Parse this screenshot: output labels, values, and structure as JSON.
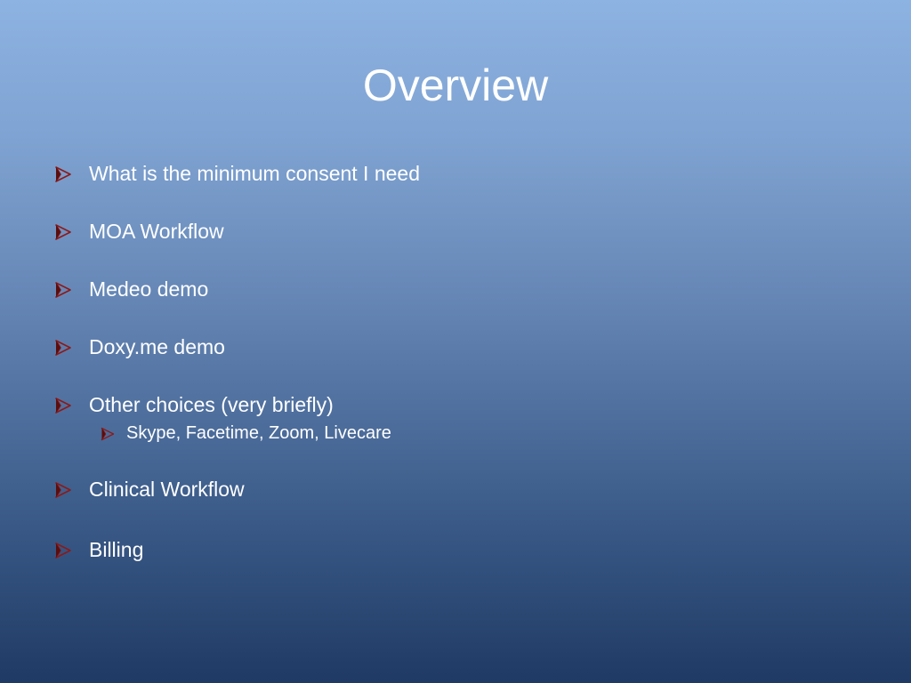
{
  "slide": {
    "title": "Overview",
    "bullet_color": "#8b1a1a",
    "items": [
      {
        "label": "What is the minimum consent I need",
        "icon": "arrow-bullet-icon"
      },
      {
        "label": "MOA Workflow",
        "icon": "arrow-bullet-icon"
      },
      {
        "label": "Medeo demo",
        "icon": "arrow-bullet-icon"
      },
      {
        "label": "Doxy.me demo",
        "icon": "arrow-bullet-icon"
      },
      {
        "label": "Other choices (very briefly)",
        "icon": "arrow-bullet-icon"
      },
      {
        "label": "Skype, Facetime, Zoom, Livecare",
        "icon": "arrow-bullet-icon",
        "level": 2
      },
      {
        "label": "Clinical Workflow",
        "icon": "arrow-bullet-icon"
      },
      {
        "label": "Billing",
        "icon": "arrow-bullet-icon"
      }
    ]
  }
}
